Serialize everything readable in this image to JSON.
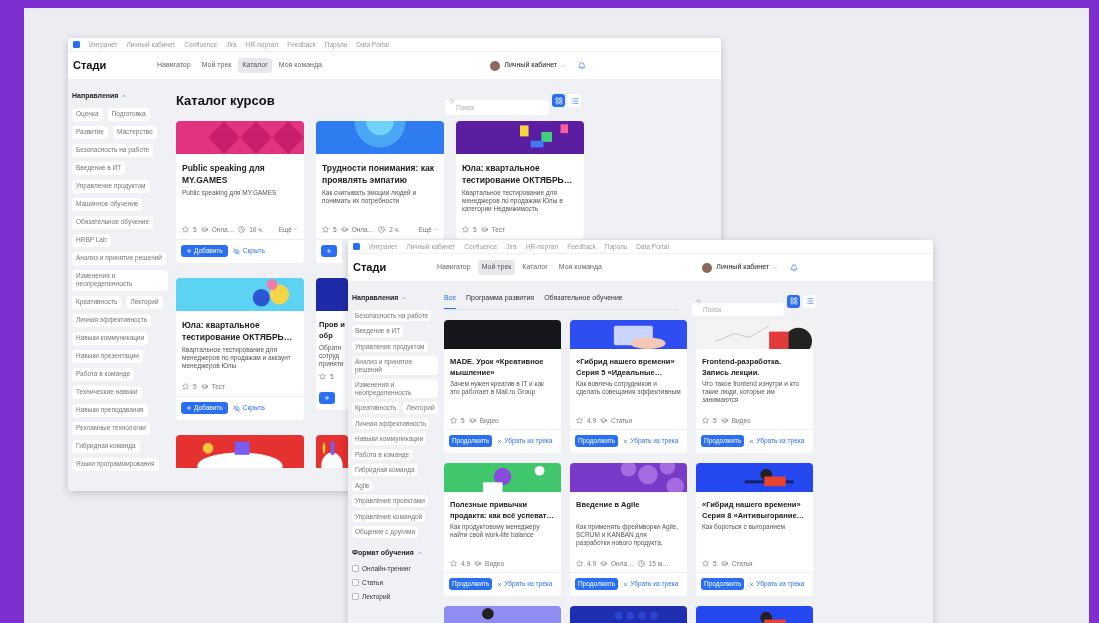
{
  "windows": [
    {
      "links": [
        "Интранет",
        "Личный кабинет",
        "Confluence",
        "Jira",
        "HR-портал",
        "Feedback",
        "Пароль",
        "Data Portal"
      ],
      "brand": "Стади",
      "nav": [
        {
          "label": "Навигатор",
          "selected": false
        },
        {
          "label": "Мой трек",
          "selected": false
        },
        {
          "label": "Каталог",
          "selected": true
        },
        {
          "label": "Моя команда",
          "selected": false
        }
      ],
      "profile": "Личный кабинет",
      "sidebar": [
        {
          "heading": "Направления",
          "expanded": true,
          "kind": "chips",
          "items": [
            "Оценка",
            "Подготовка",
            "Развитие",
            "Мастерство",
            "Безопасность на работе",
            "Введение в ИТ",
            "Управление продуктом",
            "Машинное обучение",
            "Обязательное обучение",
            "HRBP Lab",
            "Анализ и принятие решений",
            "Изменения и неопределенность",
            "Креативность",
            "Лекторий",
            "Личная эффективность",
            "Навыки коммуникации",
            "Навыки презентации",
            "Работа в команде",
            "Технические навыки",
            "Навыки преподавания",
            "Рекламные технологии",
            "Гибридная команда",
            "Языки программирования"
          ]
        }
      ],
      "title": "Каталог курсов",
      "search": {
        "placeholder": "Поиск"
      },
      "views": [
        {
          "kind": "grid",
          "selected": true
        },
        {
          "kind": "list",
          "selected": false
        }
      ],
      "card_rows": [
        {
          "cards": [
            {
              "kind": "full",
              "cover": {
                "kind": "diamonds"
              },
              "title": "Public speaking для MY.GAMES",
              "description": "Public speaking для MY.GAMES",
              "rating": "5",
              "format": "Онла…",
              "duration": "10 ч.",
              "more": "Ещё",
              "actions": [
                {
                  "kind": "add",
                  "label": "Добавить"
                },
                {
                  "kind": "hide",
                  "label": "Скрыть"
                }
              ]
            },
            {
              "kind": "clipped",
              "cover": {
                "kind": "circles"
              },
              "title": "Трудности понимания: как проявлять эмпатию",
              "description": "Как считывать эмоции людей и понимать их потребности",
              "rating": "5",
              "format": "Онла…",
              "duration": "2 ч.",
              "more": "Ещё",
              "actions": [
                {
                  "kind": "add"
                }
              ]
            },
            {
              "kind": "full",
              "cover": {
                "kind": "letters"
              },
              "title": "Юла: квартальное тестирование ОКТЯБРЬ…",
              "description": "Квартальное тестирование для менеджеров по продажам Юлы в категории Недвижимость",
              "rating": "5",
              "format": "Тест"
            }
          ]
        },
        {
          "cards": [
            {
              "kind": "full",
              "cover": {
                "kind": "people"
              },
              "title": "Юла: квартальное тестирование ОКТЯБРЬ…",
              "description": "Квартальное тестирование для менеджеров по продажам и аккаунт менеджеров Юлы",
              "rating": "5",
              "format": "Тест",
              "actions": [
                {
                  "kind": "add",
                  "label": "Добавить"
                },
                {
                  "kind": "hide",
                  "label": "Скрыть"
                }
              ]
            },
            {
              "kind": "partial",
              "cover": {
                "kind": "dark"
              },
              "title": "Пров и обр",
              "description": "Обратн сотруд приняти",
              "rating": "5",
              "actions": [
                {
                  "kind": "add"
                }
              ]
            }
          ]
        },
        {
          "cards": [
            {
              "kind": "full",
              "cover": {
                "kind": "red"
              }
            },
            {
              "kind": "partial",
              "cover": {
                "kind": "red"
              }
            }
          ]
        }
      ]
    },
    {
      "links": [
        "Интранет",
        "Личный кабинет",
        "Confluence",
        "Jira",
        "HR-портал",
        "Feedback",
        "Пароль",
        "Data Portal"
      ],
      "brand": "Стади",
      "nav": [
        {
          "label": "Навигатор",
          "selected": false
        },
        {
          "label": "Мой трек",
          "selected": true
        },
        {
          "label": "Каталог",
          "selected": false
        },
        {
          "label": "Моя команда",
          "selected": false
        }
      ],
      "profile": "Личный кабинет",
      "sidebar": [
        {
          "heading": "Направления",
          "expanded": true,
          "kind": "chips",
          "items": [
            "Безопасность на работе",
            "Введение в ИТ",
            "Управление продуктом",
            "Анализ и принятие решений",
            "Изменения и неопределенность",
            "Креативность",
            "Лекторий",
            "Личная эффективность",
            "Навыки коммуникации",
            "Работа в команде",
            "Гибридная команда",
            "Agile",
            "Управление проектами",
            "Управление командой",
            "Общение с другими"
          ]
        },
        {
          "heading": "Формат обучения",
          "expanded": true,
          "kind": "checks",
          "items": [
            {
              "label": "Онлайн-тренинг",
              "checked": false
            },
            {
              "label": "Статьи",
              "checked": false
            },
            {
              "label": "Лекторий",
              "checked": false
            }
          ]
        }
      ],
      "tabs": [
        {
          "label": "Все",
          "selected": true
        },
        {
          "label": "Программа развития",
          "selected": false
        },
        {
          "label": "Обязательное обучение",
          "selected": false
        }
      ],
      "search": {
        "placeholder": "Поиск"
      },
      "views": [
        {
          "kind": "grid",
          "selected": true
        },
        {
          "kind": "list",
          "selected": false
        }
      ],
      "card_rows": [
        {
          "cards": [
            {
              "kind": "full",
              "cover": {
                "kind": "photo"
              },
              "title": "MADE. Урок «Креативное мышление»",
              "description": "Зачем нужен креатив в IT и как это работает в Mail.ru Group",
              "rating": "5",
              "format": "Видео",
              "actions": [
                {
                  "kind": "continue",
                  "label": "Продолжить"
                },
                {
                  "kind": "remove",
                  "label": "Убрать из трека"
                }
              ]
            },
            {
              "kind": "full",
              "cover": {
                "kind": "laptop"
              },
              "title": "«Гибрид нашего времени» Серия 5 «Идеальные…",
              "description": "Как вовлечь сотрудников и сделать совещания эффективным",
              "rating": "4.9",
              "format": "Статья",
              "actions": [
                {
                  "kind": "continue",
                  "label": "Продолжить"
                },
                {
                  "kind": "remove",
                  "label": "Убрать из трека"
                }
              ]
            },
            {
              "kind": "full",
              "cover": {
                "kind": "chart"
              },
              "title": "Frontend-разработка. Запись лекции.",
              "description": "Что такое frontend изнутри и кто такие люди, которые им занимаются",
              "rating": "5",
              "format": "Видео",
              "actions": [
                {
                  "kind": "continue",
                  "label": "Продолжить"
                },
                {
                  "kind": "remove",
                  "label": "Убрать из трека"
                }
              ]
            }
          ]
        },
        {
          "cards": [
            {
              "kind": "full",
              "cover": {
                "kind": "green"
              },
              "title": "Полезные привычки продакта: как всё успеват…",
              "description": "Как продуктовому менеджеру найти свой work-life balance",
              "rating": "4.9",
              "format": "Видео",
              "actions": [
                {
                  "kind": "continue",
                  "label": "Продолжить"
                },
                {
                  "kind": "remove",
                  "label": "Убрать из трека"
                }
              ]
            },
            {
              "kind": "full",
              "cover": {
                "kind": "bubbles"
              },
              "title": "Введение в Agile",
              "description": "Как применять фреймворки Agile, SCRUM и KANBAN для разработки нового продукта.",
              "rating": "4.9",
              "format": "Онла…",
              "duration": "15 м…",
              "actions": [
                {
                  "kind": "continue",
                  "label": "Продолжить"
                },
                {
                  "kind": "remove",
                  "label": "Убрать из трека"
                }
              ]
            },
            {
              "kind": "full",
              "cover": {
                "kind": "desk"
              },
              "title": "«Гибрид нашего времени» Серия 8 «Антивыгорание…",
              "description": "Как бороться с выгоранием",
              "rating": "5",
              "format": "Статья",
              "actions": [
                {
                  "kind": "continue",
                  "label": "Продолжить"
                },
                {
                  "kind": "remove",
                  "label": "Убрать из трека"
                }
              ]
            }
          ]
        },
        {
          "cards": [
            {
              "kind": "full",
              "cover": {
                "kind": "lilac"
              }
            },
            {
              "kind": "full",
              "cover": {
                "kind": "navy"
              }
            },
            {
              "kind": "full",
              "cover": {
                "kind": "desk"
              }
            }
          ]
        }
      ]
    }
  ]
}
